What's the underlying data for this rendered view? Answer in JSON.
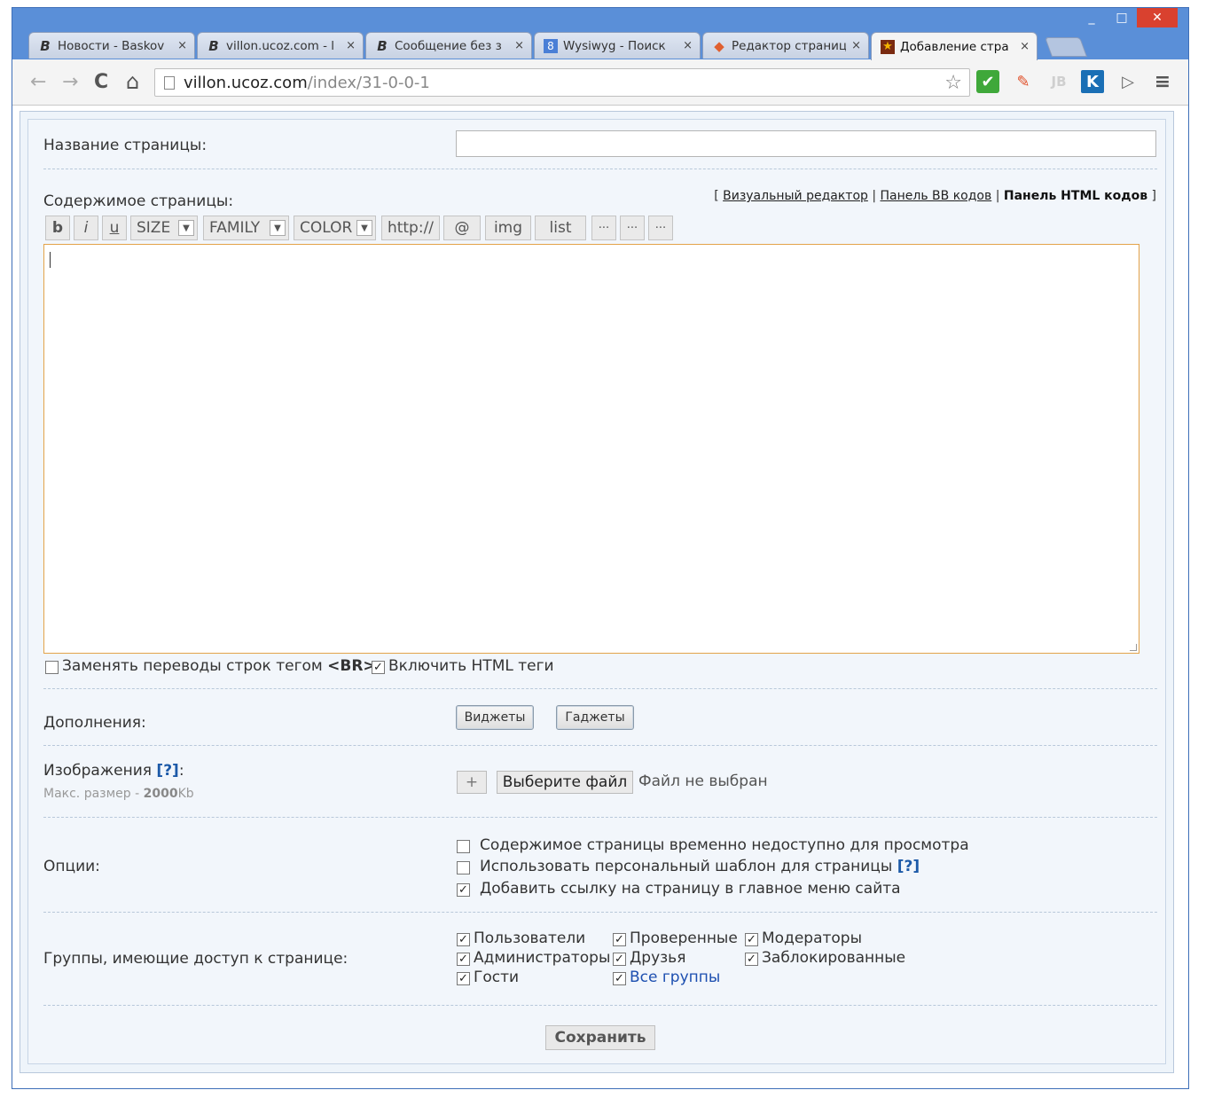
{
  "window": {
    "controls": {
      "minimize": "_",
      "maximize": "□",
      "close": "✕"
    }
  },
  "tabs": [
    {
      "title": "Новости - Baskov",
      "icon": "B",
      "close": "×"
    },
    {
      "title": "villon.ucoz.com - l",
      "icon": "B",
      "close": "×"
    },
    {
      "title": "Сообщение без з",
      "icon": "B",
      "close": "×"
    },
    {
      "title": "Wysiwyg - Поиск",
      "icon": "8",
      "close": "×"
    },
    {
      "title": "Редактор страниц",
      "icon": "◆",
      "close": "×"
    },
    {
      "title": "Добавление стра",
      "icon": "★",
      "close": "×"
    }
  ],
  "toolbar": {
    "back": "←",
    "forward": "→",
    "reload": "C",
    "home": "⌂",
    "url_host": "villon.ucoz.com",
    "url_path": "/index/31-0-0-1",
    "star": "☆",
    "menu": "≡",
    "extensions": [
      "✔",
      "✎",
      "JB",
      "K",
      "▷"
    ]
  },
  "form": {
    "page_name_label": "Название страницы:",
    "page_name_value": "",
    "content_label": "Содержимое страницы:",
    "editor_links": {
      "open": "[",
      "visual": "Визуальный редактор",
      "sep": "|",
      "bb": "Панель BB кодов",
      "html": "Панель HTML кодов",
      "close": "]"
    },
    "bb_buttons": {
      "bold": "b",
      "italic": "i",
      "underline": "u",
      "size": "SIZE",
      "family": "FAMILY",
      "color": "COLOR",
      "url": "http://",
      "email": "@",
      "img": "img",
      "list": "list",
      "more1": "···",
      "more2": "···",
      "more3": "···",
      "dropdown": "▼"
    },
    "content_value": "",
    "replace_br_label_prefix": "Заменять переводы строк тегом",
    "replace_br_tag": "<BR>",
    "replace_br_checked": false,
    "enable_html_label": "Включить HTML теги",
    "enable_html_checked": true,
    "addons_label": "Дополнения:",
    "widgets_button": "Виджеты",
    "gadgets_button": "Гаджеты",
    "images_label": "Изображения",
    "images_help": "[?]",
    "images_colon": ":",
    "max_size_prefix": "Макс. размер -",
    "max_size_value": "2000",
    "max_size_unit": "Kb",
    "add_file": "+",
    "choose_file": "Выберите файл",
    "no_file": "Файл не выбран",
    "options_label": "Опции:",
    "options": [
      {
        "label": "Содержимое страницы временно недоступно для просмотра",
        "checked": false
      },
      {
        "label": "Использовать персональный шаблон для страницы",
        "checked": false,
        "help": "[?]"
      },
      {
        "label": "Добавить ссылку на страницу в главное меню сайта",
        "checked": true
      }
    ],
    "groups_label": "Группы, имеющие доступ к странице:",
    "groups": [
      {
        "label": "Пользователи",
        "checked": true
      },
      {
        "label": "Проверенные",
        "checked": true
      },
      {
        "label": "Модераторы",
        "checked": true
      },
      {
        "label": "Администраторы",
        "checked": true
      },
      {
        "label": "Друзья",
        "checked": true
      },
      {
        "label": "Заблокированные",
        "checked": true
      },
      {
        "label": "Гости",
        "checked": true
      },
      {
        "label": "Все группы",
        "checked": true
      }
    ],
    "checkmark": "✓",
    "save_button": "Сохранить"
  }
}
